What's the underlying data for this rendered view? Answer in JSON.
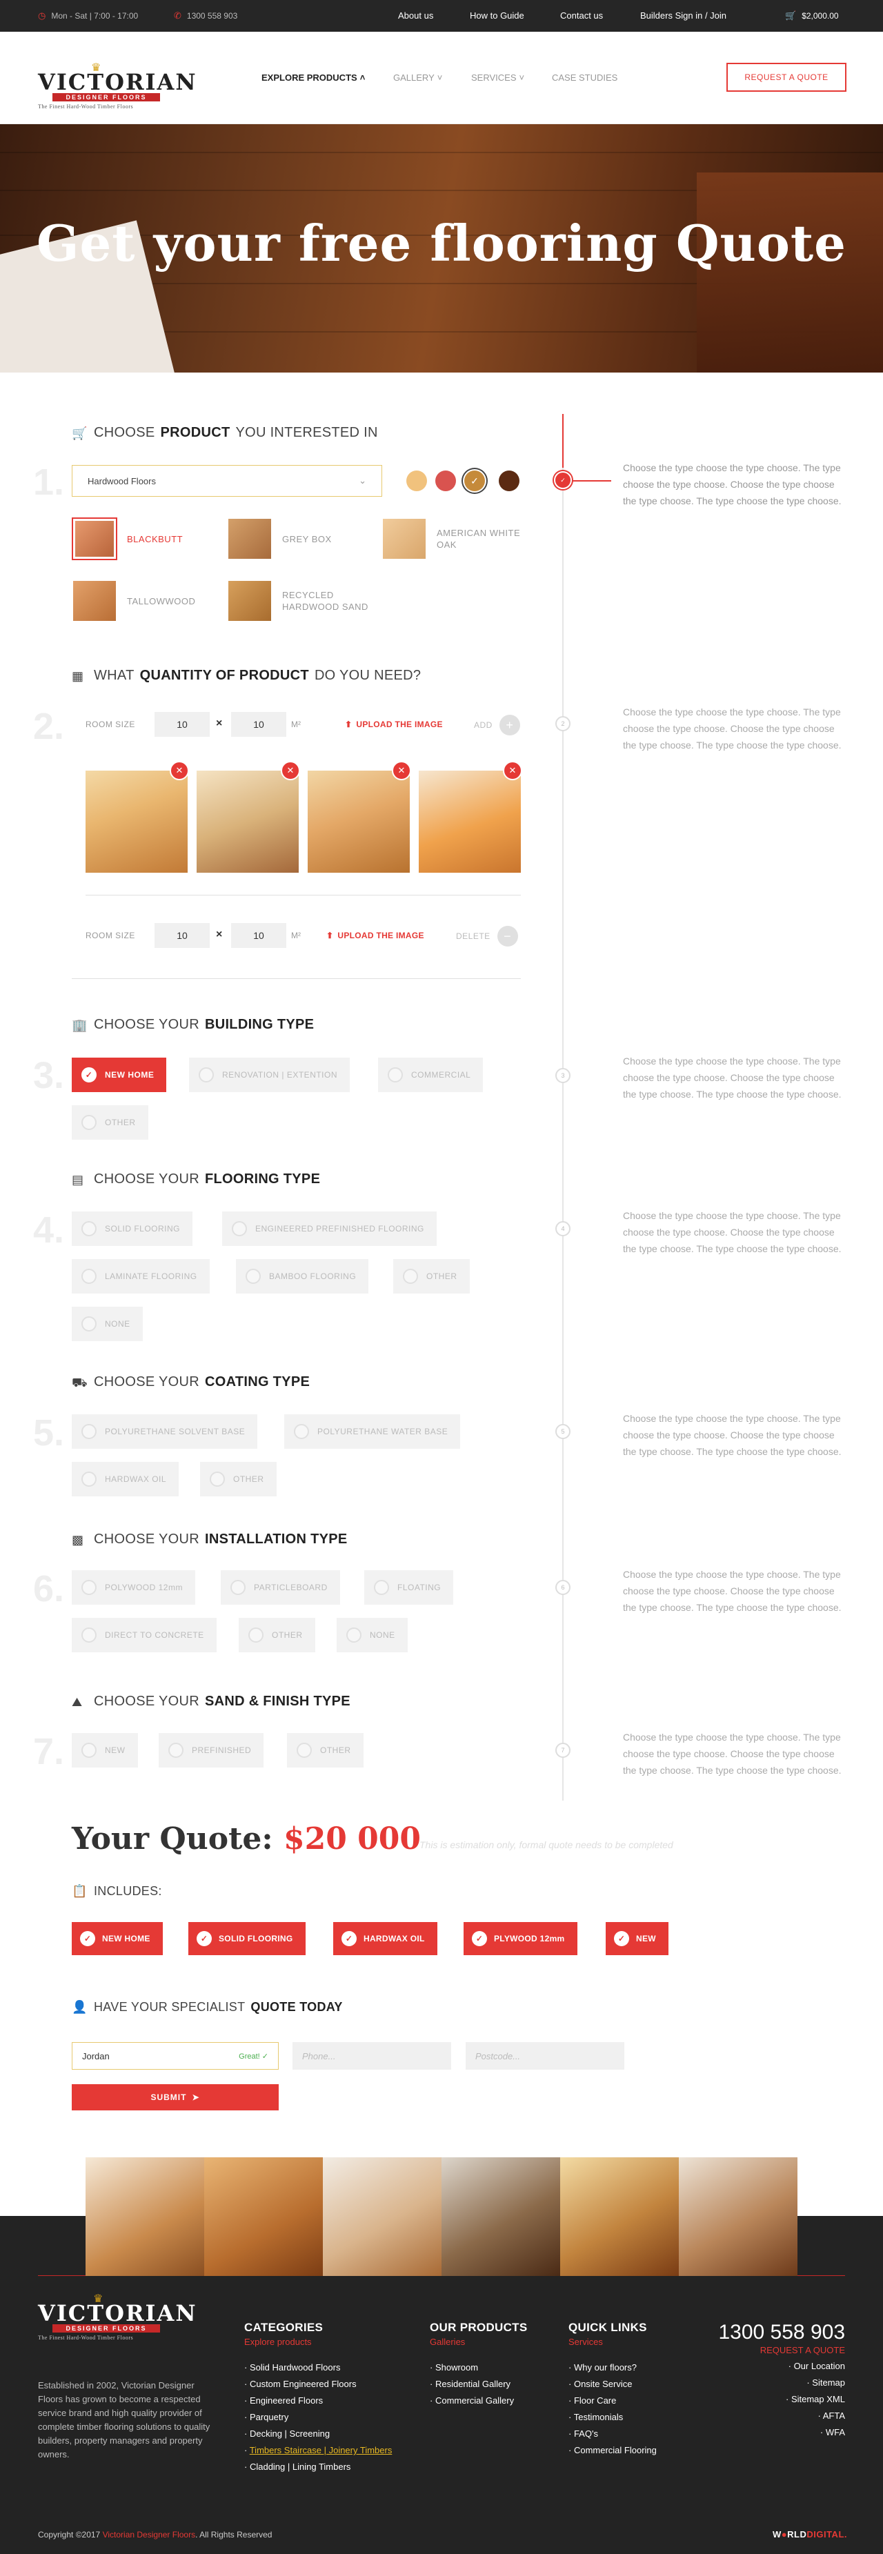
{
  "topbar": {
    "hours": "Mon - Sat | 7:00 - 17:00",
    "phone": "1300 558 903",
    "nav": [
      "About us",
      "How to Guide",
      "Contact us",
      "Builders Sign in / Join"
    ],
    "cart": "$2,000.00"
  },
  "logo": {
    "main": "VICTORIAN",
    "band": "DESIGNER FLOORS",
    "tagline": "The Finest Hard-Wood Timber Floors"
  },
  "menu": {
    "explore": "EXPLORE PRODUCTS",
    "gallery": "GALLERY",
    "services": "SERVICES",
    "case": "CASE STUDIES"
  },
  "quote_button": "REQUEST A QUOTE",
  "hero_title": "Get your free flooring Quote",
  "help_text": "Choose the type choose the type choose. The type choose the type choose. Choose the type choose the type choose. The type choose the type choose.",
  "step1": {
    "num": "1.",
    "title_pre": "CHOOSE",
    "title_bold": "PRODUCT",
    "title_post": "YOU INTERESTED IN",
    "dropdown": "Hardwood Floors",
    "swatch_colors": [
      "#f1c27d",
      "#d9534f",
      "#c58a3a",
      "#5b2a12"
    ],
    "woods": [
      "BLACKBUTT",
      "GREY BOX",
      "AMERICAN WHITE OAK",
      "TALLOWWOOD",
      "RECYCLED HARDWOOD SAND"
    ]
  },
  "step2": {
    "num": "2.",
    "title_pre": "WHAT",
    "title_bold": "QUANTITY OF PRODUCT",
    "title_post": "DO YOU NEED?",
    "room_size": "ROOM SIZE",
    "w": "10",
    "h": "10",
    "times": "×",
    "unit": "M²",
    "upload": "UPLOAD THE IMAGE",
    "add": "ADD",
    "delete": "DELETE"
  },
  "step3": {
    "num": "3.",
    "title_pre": "CHOOSE YOUR",
    "title_bold": "BUILDING TYPE",
    "options": [
      "NEW HOME",
      "RENOVATION | EXTENTION",
      "COMMERCIAL",
      "OTHER"
    ]
  },
  "step4": {
    "num": "4.",
    "title_pre": "CHOOSE YOUR",
    "title_bold": "FLOORING TYPE",
    "options": [
      "SOLID FLOORING",
      "ENGINEERED PREFINISHED FLOORING",
      "LAMINATE FLOORING",
      "BAMBOO FLOORING",
      "OTHER",
      "NONE"
    ]
  },
  "step5": {
    "num": "5.",
    "title_pre": "CHOOSE YOUR",
    "title_bold": "COATING TYPE",
    "options": [
      "POLYURETHANE SOLVENT BASE",
      "POLYURETHANE WATER BASE",
      "HARDWAX OIL",
      "OTHER"
    ]
  },
  "step6": {
    "num": "6.",
    "title_pre": "CHOOSE YOUR",
    "title_bold": "INSTALLATION TYPE",
    "options": [
      "POLYWOOD 12mm",
      "PARTICLEBOARD",
      "FLOATING",
      "DIRECT TO CONCRETE",
      "OTHER",
      "NONE"
    ]
  },
  "step7": {
    "num": "7.",
    "title_pre": "CHOOSE YOUR",
    "title_bold": "SAND & FINISH TYPE",
    "options": [
      "NEW",
      "PREFINISHED",
      "OTHER"
    ]
  },
  "timeline_steps": [
    "✓",
    "2",
    "3",
    "4",
    "5",
    "6",
    "7"
  ],
  "quote": {
    "label": "Your Quote:",
    "amount": "$20 000",
    "note": "This is estimation only, formal quote needs to be completed"
  },
  "includes": {
    "title": "INCLUDES:",
    "items": [
      "NEW HOME",
      "SOLID FLOORING",
      "HARDWAX OIL",
      "PLYWOOD 12mm",
      "NEW"
    ]
  },
  "specialist": {
    "title_pre": "HAVE YOUR SPECIALIST",
    "title_bold": "QUOTE TODAY",
    "name_value": "Jordan",
    "name_status": "Great!",
    "phone_placeholder": "Phone...",
    "postcode_placeholder": "Postcode...",
    "submit": "SUBMIT"
  },
  "footer": {
    "desc": "Established in 2002, Victorian Designer Floors has grown to become a respected service brand and high quality provider of complete timber flooring solutions to quality builders, property managers and property owners.",
    "categories": {
      "title": "CATEGORIES",
      "sub": "Explore products",
      "items": [
        "Solid Hardwood Floors",
        "Custom Engineered Floors",
        "Engineered Floors",
        "Parquetry",
        "Decking | Screening",
        "Timbers Staircase | Joinery Timbers",
        "Cladding | Lining Timbers"
      ]
    },
    "products": {
      "title": "OUR PRODUCTS",
      "sub": "Galleries",
      "items": [
        "Showroom",
        "Residential Gallery",
        "Commercial Gallery"
      ]
    },
    "quick": {
      "title": "QUICK LINKS",
      "sub": "Services",
      "items": [
        "Why our floors?",
        "Onsite Service",
        "Floor Care",
        "Testimonials",
        "FAQ's",
        "Commercial Flooring"
      ]
    },
    "phone": "1300 558 903",
    "request": "REQUEST A QUOTE",
    "links": [
      "Our Location",
      "Sitemap",
      "Sitemap XML",
      "AFTA",
      "WFA"
    ],
    "copyright_pre": "Copyright ©2017",
    "copyright_brand": "Victorian Designer Floors",
    "copyright_post": ". All Rights Reserved",
    "agency_a": "W",
    "agency_b": "RLD",
    "agency_c": "DIGITAL."
  },
  "colors": {
    "accent": "#e53935",
    "dark": "#262626"
  }
}
